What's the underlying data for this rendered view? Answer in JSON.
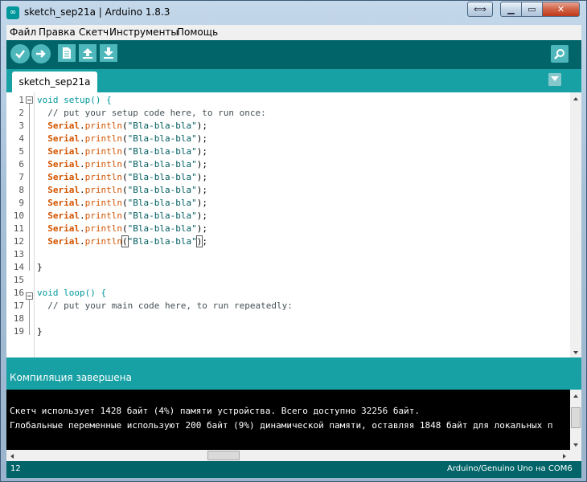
{
  "window": {
    "title": "sketch_sep21a | Arduino 1.8.3",
    "icon": "arduino-icon"
  },
  "menu": [
    "Файл",
    "Правка",
    "Скетч",
    "Инструменты",
    "Помощь"
  ],
  "toolbar": {
    "verify": "check-icon",
    "upload": "arrow-right-icon",
    "new": "new-file-icon",
    "open": "arrow-up-icon",
    "save": "arrow-down-icon",
    "serial_monitor": "magnifier-icon"
  },
  "tabs": [
    {
      "label": "sketch_sep21a",
      "active": true
    }
  ],
  "editor": {
    "line_numbers": [
      "1",
      "2",
      "3",
      "4",
      "5",
      "6",
      "7",
      "8",
      "9",
      "10",
      "11",
      "12",
      "13",
      "14",
      "15",
      "16",
      "17",
      "18",
      "19"
    ],
    "lines": [
      "void setup() {",
      "  // put your setup code here, to run once:",
      "  Serial.println(\"Bla-bla-bla\");",
      "  Serial.println(\"Bla-bla-bla\");",
      "  Serial.println(\"Bla-bla-bla\");",
      "  Serial.println(\"Bla-bla-bla\");",
      "  Serial.println(\"Bla-bla-bla\");",
      "  Serial.println(\"Bla-bla-bla\");",
      "  Serial.println(\"Bla-bla-bla\");",
      "  Serial.println(\"Bla-bla-bla\");",
      "  Serial.println(\"Bla-bla-bla\");",
      "  Serial.println(\"Bla-bla-bla\");",
      "",
      "}",
      "",
      "void loop() {",
      "  // put your main code here, to run repeatedly:",
      "",
      "}"
    ]
  },
  "status": {
    "message": "Компиляция завершена"
  },
  "console": {
    "lines": [
      "Скетч использует 1428 байт (4%) памяти устройства. Всего доступно 32256 байт.",
      "Глобальные переменные используют 200 байт (9%) динамической памяти, оставляя 1848 байт для локальных п"
    ]
  },
  "footer": {
    "line": "12",
    "board": "Arduino/Genuino Uno на COM6"
  },
  "colors": {
    "teal_dark": "#006468",
    "teal_light": "#17a1a5",
    "button": "#4db7bb",
    "keyword": "#00979c",
    "function": "#d35400"
  }
}
